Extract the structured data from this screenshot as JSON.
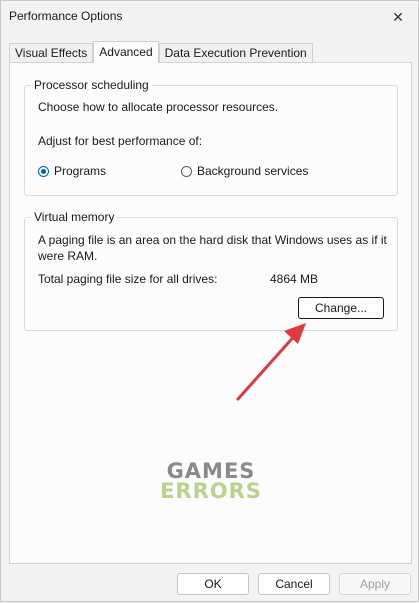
{
  "window": {
    "title": "Performance Options"
  },
  "tabs": [
    {
      "label": "Visual Effects"
    },
    {
      "label": "Advanced"
    },
    {
      "label": "Data Execution Prevention"
    }
  ],
  "processor": {
    "group_label": "Processor scheduling",
    "description": "Choose how to allocate processor resources.",
    "adjust_label": "Adjust for best performance of:",
    "options": [
      {
        "label": "Programs",
        "checked": true
      },
      {
        "label": "Background services",
        "checked": false
      }
    ]
  },
  "virtual_memory": {
    "group_label": "Virtual memory",
    "description_line1": "A paging file is an area on the hard disk that Windows uses as if it",
    "description_line2": "were RAM.",
    "total_label": "Total paging file size for all drives:",
    "total_value": "4864 MB",
    "change_button": "Change..."
  },
  "watermark": {
    "line1": "GAMES",
    "line2": "ERRORS"
  },
  "footer": {
    "ok": "OK",
    "cancel": "Cancel",
    "apply": "Apply"
  },
  "colors": {
    "accent": "#0063b1",
    "arrow": "#e0393b"
  }
}
